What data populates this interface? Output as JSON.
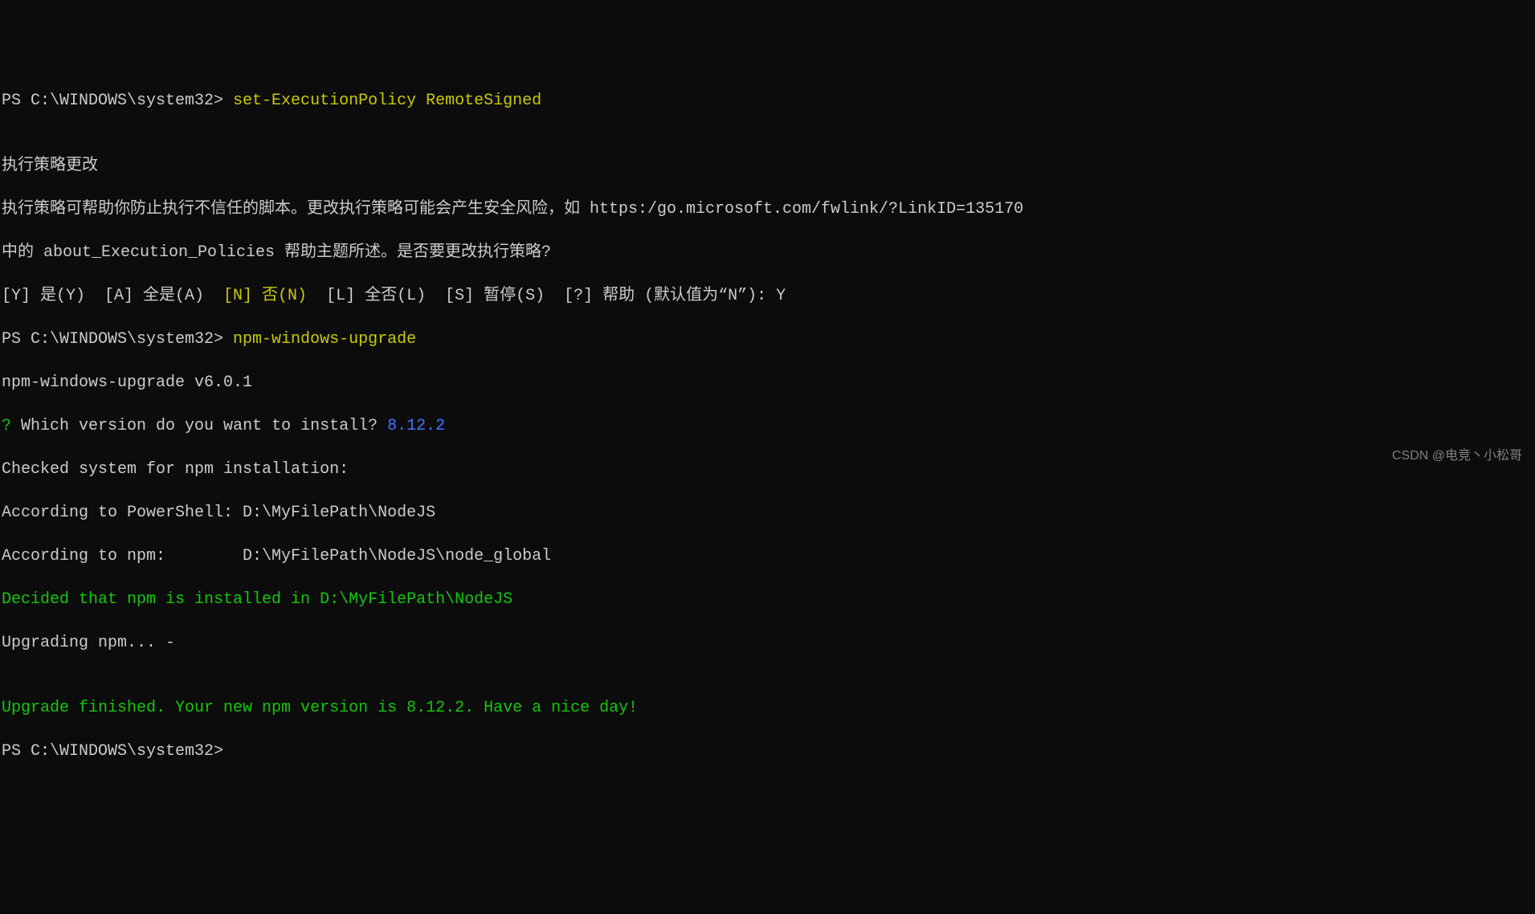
{
  "prompt1": "PS C:\\WINDOWS\\system32> ",
  "cmd1": "set-ExecutionPolicy RemoteSigned",
  "blank1": "",
  "policy_title": "执行策略更改",
  "policy_desc1": "执行策略可帮助你防止执行不信任的脚本。更改执行策略可能会产生安全风险，如 https:/go.microsoft.com/fwlink/?LinkID=135170",
  "policy_desc2": "中的 about_Execution_Policies 帮助主题所述。是否要更改执行策略?",
  "policy_options": "[Y] 是(Y)  [A] 全是(A)  ",
  "policy_n": "[N] 否(N)",
  "policy_options2": "  [L] 全否(L)  [S] 暂停(S)  [?] 帮助 (默认值为“N”): Y",
  "prompt2": "PS C:\\WINDOWS\\system32> ",
  "cmd2": "npm-windows-upgrade",
  "version_line": "npm-windows-upgrade v6.0.1",
  "question_mark": "?",
  "question_text": " Which version do you want to install? ",
  "version_selected": "8.12.2",
  "check_line": "Checked system for npm installation:",
  "ps_path": "According to PowerShell: D:\\MyFilePath\\NodeJS",
  "npm_path": "According to npm:        D:\\MyFilePath\\NodeJS\\node_global",
  "decided": "Decided that npm is installed in D:\\MyFilePath\\NodeJS",
  "upgrading": "Upgrading npm... -",
  "blank2": "",
  "finished": "Upgrade finished. Your new npm version is 8.12.2. Have a nice day!",
  "prompt3": "PS C:\\WINDOWS\\system32>",
  "watermark": "CSDN @电竞丶小松哥"
}
